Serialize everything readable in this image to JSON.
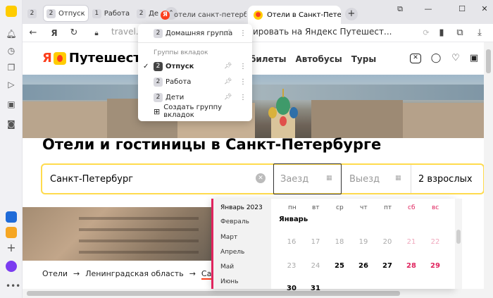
{
  "browser": {
    "tab_groups": [
      {
        "count": "2",
        "label": ""
      },
      {
        "count": "2",
        "label": "Отпуск",
        "active": true
      },
      {
        "count": "1",
        "label": "Работа"
      },
      {
        "count": "2",
        "label": "Де"
      }
    ],
    "tabs": [
      {
        "title": "отели санкт-петербурга —"
      },
      {
        "title": "Отели в Санкт-Петербурге"
      }
    ],
    "tab_close": "✕",
    "new_tab": "+",
    "address": "travel.yand",
    "page_title": "е — забронировать на Яндекс Путешест...",
    "win_controls": {
      "min": "—",
      "max": "☐",
      "close": "✕"
    }
  },
  "tab_group_menu": {
    "top_group": {
      "count": "2",
      "label": "Домашняя группа"
    },
    "heading": "Группы вкладок",
    "groups": [
      {
        "count": "2",
        "label": "Отпуск",
        "checked": true
      },
      {
        "count": "2",
        "label": "Работа"
      },
      {
        "count": "2",
        "label": "Дети"
      }
    ],
    "create_label": "Создать группу вкладок"
  },
  "site": {
    "logo_ya": "Я",
    "logo_text": "Путешествия",
    "nav": [
      "Ж/д билеты",
      "Автобусы",
      "Туры"
    ],
    "title": "Отели и гостиницы в Санкт-Петербурге",
    "search": {
      "city": "Санкт-Петербург",
      "checkin_placeholder": "Заезд",
      "checkout_placeholder": "Выезд",
      "guests": "2 взрослых"
    },
    "breadcrumbs": [
      "Отели",
      "Ленинградская область",
      "Санкт-Петер"
    ],
    "bc_arrow": "→"
  },
  "calendar": {
    "months": [
      "Январь 2023",
      "Февраль",
      "Март",
      "Апрель",
      "Май",
      "Июнь"
    ],
    "weekdays": [
      "пн",
      "вт",
      "ср",
      "чт",
      "пт",
      "сб",
      "вс"
    ],
    "month_title": "Январь",
    "week1": [
      "16",
      "17",
      "18",
      "19",
      "20",
      "21",
      "22"
    ],
    "week2": [
      "23",
      "24",
      "25",
      "26",
      "27",
      "28",
      "29"
    ],
    "week3": [
      "30",
      "31"
    ]
  }
}
